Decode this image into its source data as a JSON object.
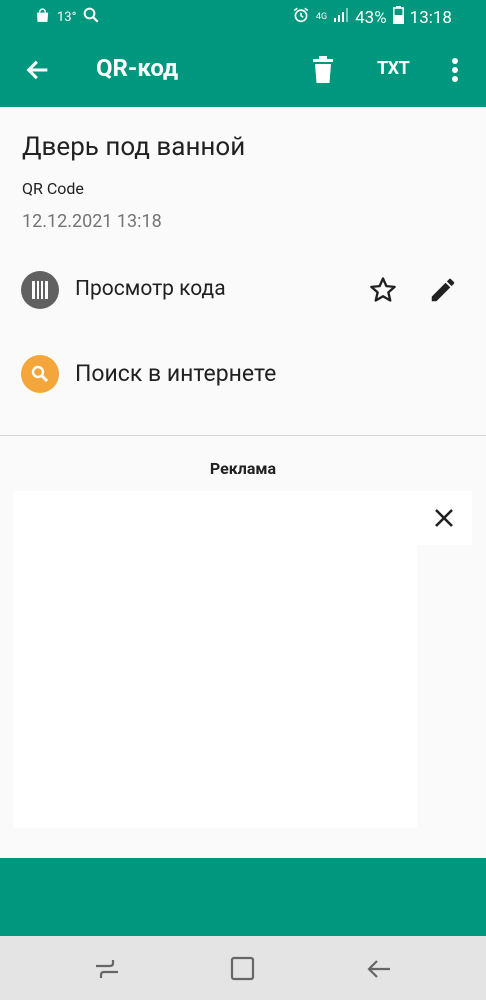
{
  "status_bar": {
    "temperature": "13°",
    "network": "4G",
    "battery_percent": "43%",
    "time": "13:18"
  },
  "app_bar": {
    "title": "QR-код",
    "txt_label": "TXT"
  },
  "item": {
    "title": "Дверь под ванной",
    "format": "QR Code",
    "date": "12.12.2021 13:18"
  },
  "actions": {
    "view_code": "Просмотр кода",
    "search_web": "Поиск в интернете"
  },
  "ad": {
    "label": "Реклама"
  },
  "colors": {
    "primary": "#00977f",
    "search_accent": "#f5a63b",
    "view_icon_bg": "#616161"
  }
}
